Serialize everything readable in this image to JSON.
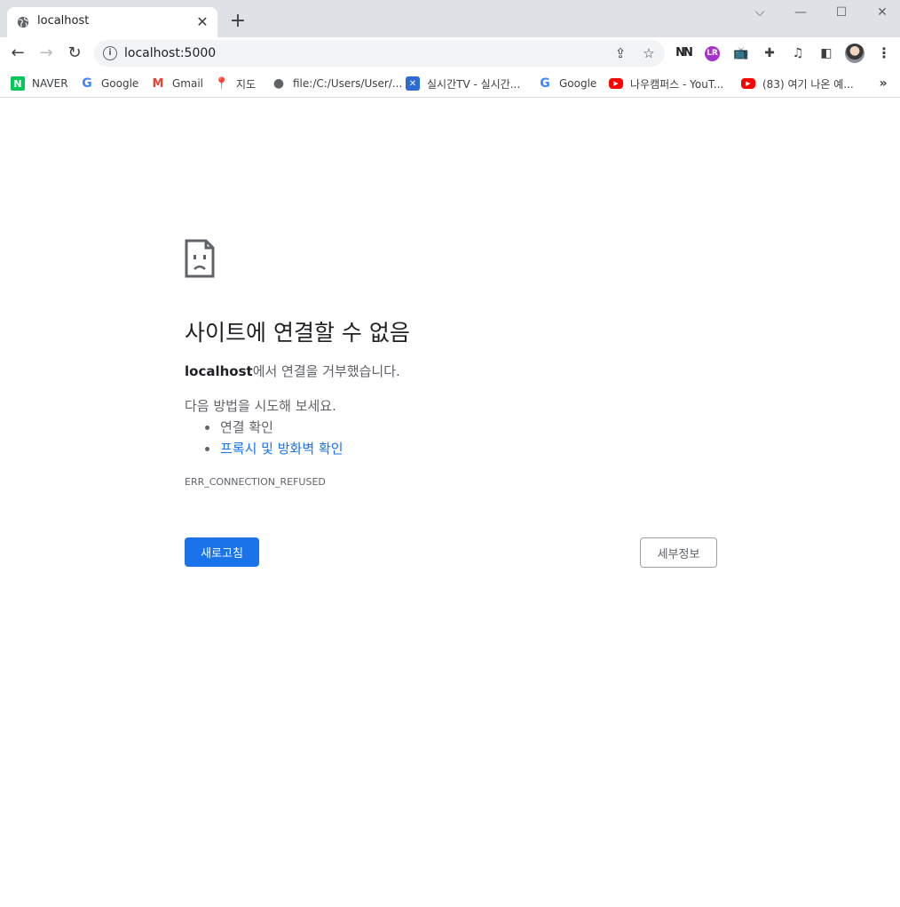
{
  "tab": {
    "title": "localhost",
    "favicon": "globe-icon",
    "close": "✕"
  },
  "new_tab": "+",
  "window_controls": {
    "dropdown": "⌵",
    "minimize": "—",
    "maximize": "☐",
    "close": "✕"
  },
  "toolbar": {
    "back": "←",
    "forward": "→",
    "reload": "↻",
    "url": "localhost:5000",
    "share": "⇪",
    "star": "☆",
    "menu": "⋮"
  },
  "extensions": [
    "ublock-icon",
    "language-reactor-icon",
    "tv-icon",
    "puzzle-icon",
    "media-icon",
    "side-panel-icon"
  ],
  "bookmarks": [
    {
      "label": "NAVER",
      "icon": "naver-icon"
    },
    {
      "label": "Google",
      "icon": "google-icon"
    },
    {
      "label": "Gmail",
      "icon": "gmail-icon"
    },
    {
      "label": "지도",
      "icon": "maps-icon"
    },
    {
      "label": "file:/C:/Users/User/...",
      "icon": "globe-icon"
    },
    {
      "label": "실시간TV - 실시간...",
      "icon": "tv-icon"
    },
    {
      "label": "Google",
      "icon": "google-icon"
    },
    {
      "label": "나우캠퍼스 - YouT...",
      "icon": "youtube-icon"
    },
    {
      "label": "(83) 여기 나온 예...",
      "icon": "youtube-icon"
    }
  ],
  "bookmarks_more": "»",
  "error": {
    "heading": "사이트에 연결할 수 없음",
    "host": "localhost",
    "summary_rest": "에서 연결을 거부했습니다.",
    "suggest_intro": "다음 방법을 시도해 보세요.",
    "suggestions": [
      "연결 확인",
      "프록시 및 방화벽 확인"
    ],
    "code": "ERR_CONNECTION_REFUSED",
    "reload_label": "새로고침",
    "details_label": "세부정보"
  },
  "colors": {
    "accent": "#1a73e8",
    "tabstrip": "#dee1e6",
    "omnibox": "#f1f3f4"
  }
}
